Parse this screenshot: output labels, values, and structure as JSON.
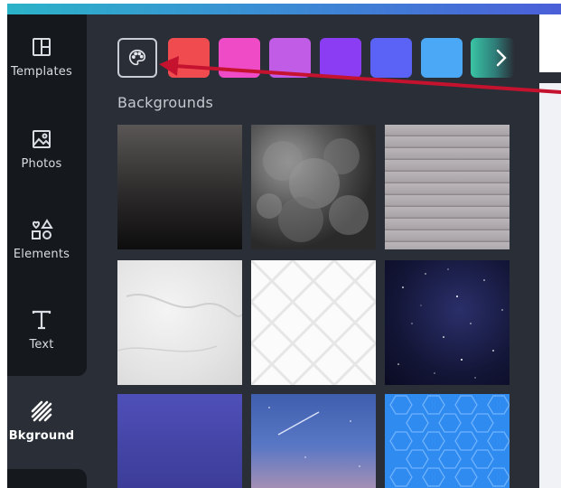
{
  "sidebar": {
    "items": [
      {
        "label": "Templates",
        "icon": "templates-icon"
      },
      {
        "label": "Photos",
        "icon": "photos-icon"
      },
      {
        "label": "Elements",
        "icon": "elements-icon"
      },
      {
        "label": "Text",
        "icon": "text-icon"
      },
      {
        "label": "Bkground",
        "icon": "background-icon",
        "active": true
      }
    ]
  },
  "panel": {
    "section_title": "Backgrounds",
    "swatches": [
      "#f04c50",
      "#ef4bc7",
      "#c05ce6",
      "#8a3df2",
      "#5a63f5",
      "#4aa8f7",
      "#39c4a4"
    ],
    "tiles": [
      "dark-gradient",
      "smoke",
      "wood-planks",
      "marble",
      "white-lattice",
      "night-sky",
      "purple-gradient",
      "meteor-sky",
      "blue-hexagons"
    ]
  },
  "colors": {
    "accent_arrow": "#c4122f",
    "sidebar_bg": "#15181d",
    "panel_bg": "#2a2f37"
  }
}
